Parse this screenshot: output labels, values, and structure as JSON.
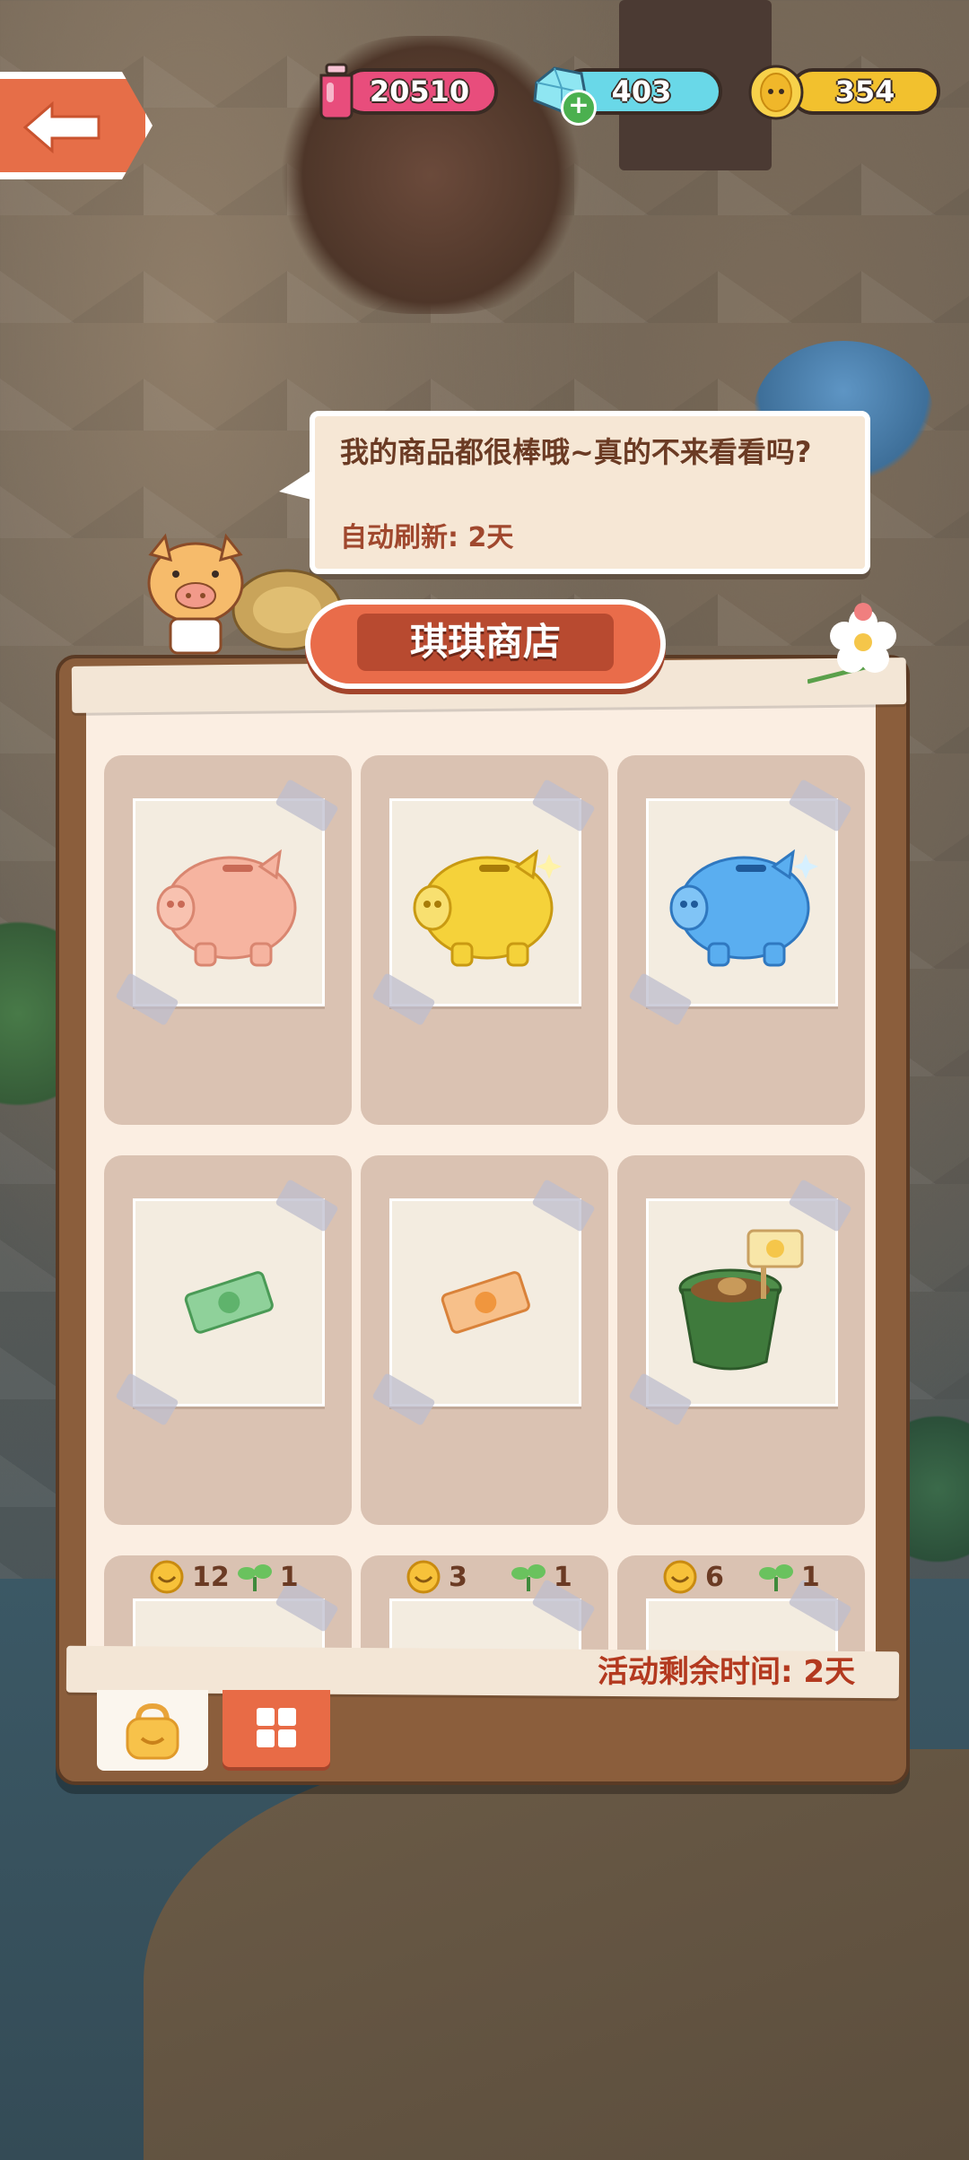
{
  "header": {
    "potion_count": "20510",
    "gem_count": "403",
    "coin_count": "354"
  },
  "dialog": {
    "message": "我的商品都很棒哦~真的不来看看吗?",
    "refresh_label": "自动刷新: 2天"
  },
  "shop": {
    "title": "琪琪商店",
    "items": [
      {
        "name": "pink-piggy-bank"
      },
      {
        "name": "gold-piggy-bank"
      },
      {
        "name": "blue-piggy-bank"
      },
      {
        "name": "green-ticket"
      },
      {
        "name": "orange-ticket"
      },
      {
        "name": "seed-pot"
      }
    ],
    "partial_items": [
      {
        "smiley_cost": "12",
        "sprout_cost": "1"
      },
      {
        "smiley_cost": "3",
        "sprout_cost": "1"
      },
      {
        "smiley_cost": "6",
        "sprout_cost": "1"
      }
    ],
    "remaining_time_label": "活动剩余时间: 2天"
  },
  "tabs": [
    {
      "icon": "shopping-bag-icon"
    },
    {
      "icon": "grid-icon"
    }
  ],
  "colors": {
    "accent": "#e96c4a",
    "panel_brown": "#8b5e3c",
    "card_bg": "#dac2b2",
    "text_brown": "#6b3b24",
    "remain_red": "#b3391f"
  }
}
